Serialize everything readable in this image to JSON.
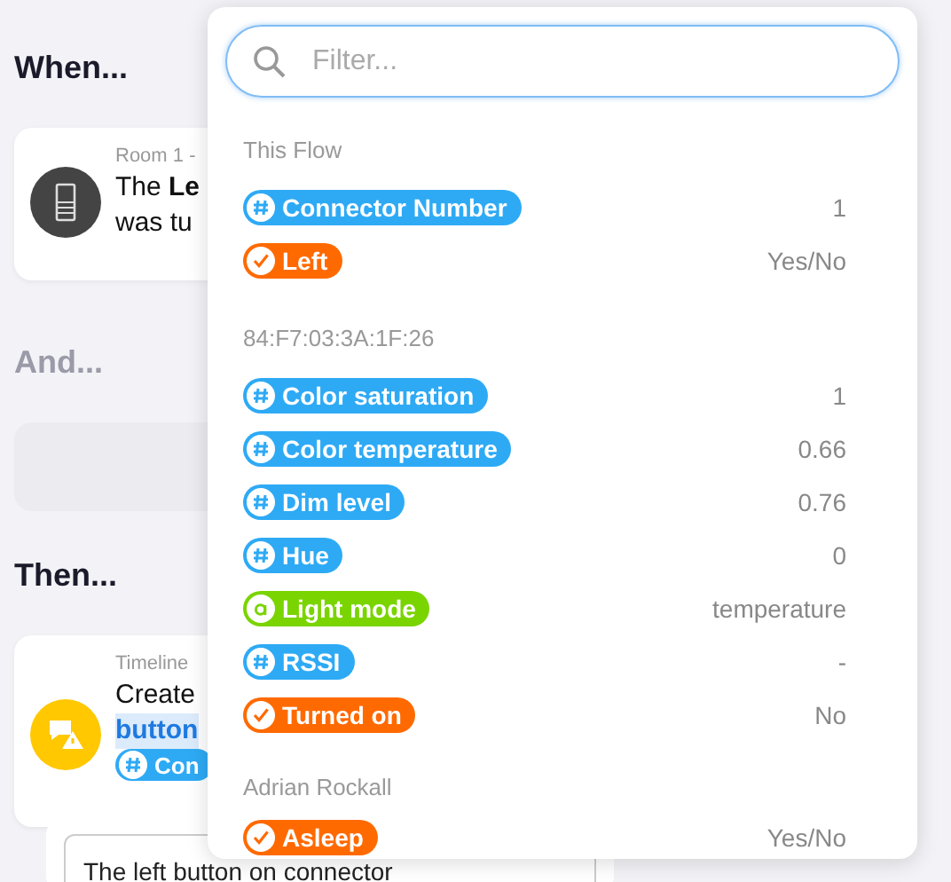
{
  "sections": [
    {
      "heading": "When...",
      "muted": false
    },
    {
      "heading": "And...",
      "muted": true
    },
    {
      "heading": "Then...",
      "muted": false
    }
  ],
  "when_card": {
    "subtitle": "Room 1 -",
    "line_1": "The **Le**",
    "line_2": "was tu"
  },
  "then_card": {
    "subtitle": "Timeline",
    "line_1": "Create",
    "line_2": "button",
    "tag": {
      "kind": "number",
      "label": "Con"
    }
  },
  "text_input": {
    "value": "The left button on connector"
  },
  "popup": {
    "search": {
      "placeholder": "Filter..."
    },
    "groups": [
      {
        "title": "This Flow",
        "items": [
          {
            "kind": "number",
            "label": "Connector Number",
            "value": "1"
          },
          {
            "kind": "boolean",
            "label": "Left",
            "value": "Yes/No"
          }
        ]
      },
      {
        "title": "84:F7:03:3A:1F:26",
        "items": [
          {
            "kind": "number",
            "label": "Color saturation",
            "value": "1"
          },
          {
            "kind": "number",
            "label": "Color temperature",
            "value": "0.66"
          },
          {
            "kind": "number",
            "label": "Dim level",
            "value": "0.76"
          },
          {
            "kind": "number",
            "label": "Hue",
            "value": "0"
          },
          {
            "kind": "text",
            "label": "Light mode",
            "value": "temperature"
          },
          {
            "kind": "number",
            "label": "RSSI",
            "value": "-"
          },
          {
            "kind": "boolean",
            "label": "Turned on",
            "value": "No"
          }
        ]
      },
      {
        "title": "Adrian Rockall",
        "items": [
          {
            "kind": "boolean",
            "label": "Asleep",
            "value": "Yes/No"
          }
        ]
      }
    ]
  }
}
